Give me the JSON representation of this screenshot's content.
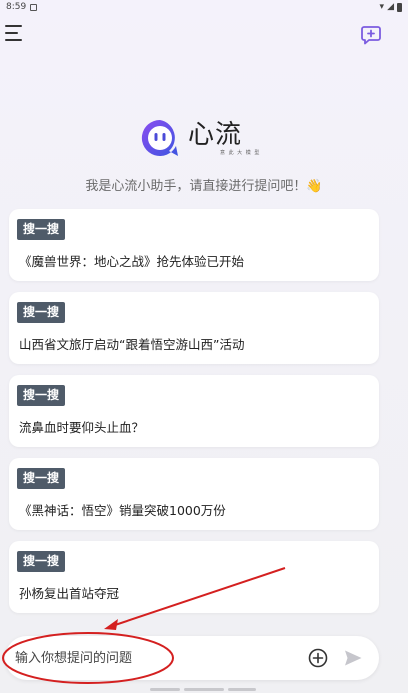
{
  "status_bar": {
    "time": "8:59"
  },
  "app": {
    "name": "心流",
    "tagline": "意 此 大 模 型",
    "greeting": "我是心流小助手，请直接进行提问吧！👋"
  },
  "cards": [
    {
      "tag": "搜一搜",
      "text": "《魔兽世界：地心之战》抢先体验已开始"
    },
    {
      "tag": "搜一搜",
      "text": "山西省文旅厅启动“跟着悟空游山西”活动"
    },
    {
      "tag": "搜一搜",
      "text": "流鼻血时要仰头止血？"
    },
    {
      "tag": "搜一搜",
      "text": "《黑神话：悟空》销量突破1000万份"
    },
    {
      "tag": "搜一搜",
      "text": "孙杨复出首站夺冠"
    }
  ],
  "input": {
    "placeholder": "输入你想提问的问题",
    "value": ""
  },
  "colors": {
    "accent": "#6e5ae6",
    "annotation": "#d42020",
    "tag_bg": "#4f5b69"
  },
  "icons": [
    "menu-icon",
    "new-chat-icon",
    "plus-circle-icon",
    "send-icon"
  ]
}
